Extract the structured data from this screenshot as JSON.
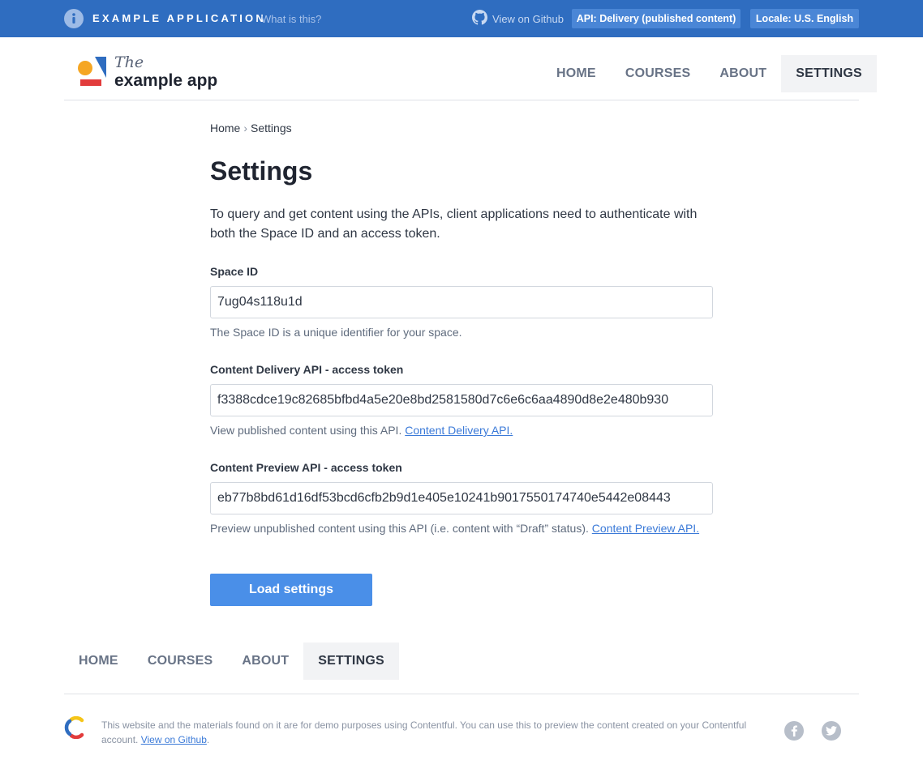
{
  "topbar": {
    "app_title": "EXAMPLE APPLICATION",
    "what_link": "What is this?",
    "github_link": "View on Github",
    "api_pill": "API: Delivery (published content)",
    "locale_pill": "Locale: U.S. English",
    "bg_color": "#2f6dc0",
    "icons": [
      "info-icon",
      "github-icon"
    ]
  },
  "logo": {
    "the": "The",
    "word": "example app"
  },
  "nav": {
    "items": [
      "HOME",
      "COURSES",
      "ABOUT",
      "SETTINGS"
    ],
    "active": "SETTINGS"
  },
  "breadcrumb": {
    "home": "Home",
    "separator": "›",
    "current": "Settings"
  },
  "page": {
    "title": "Settings",
    "intro": "To query and get content using the APIs, client applications need to authenticate with both the Space ID and an access token."
  },
  "fields": {
    "space_id": {
      "label": "Space ID",
      "value": "7ug04s118u1d",
      "help": "The Space ID is a unique identifier for your space."
    },
    "delivery_token": {
      "label": "Content Delivery API - access token",
      "value": "f3388cdce19c82685bfbd4a5e20e8bd2581580d7c6e6c6aa4890d8e2e480b930",
      "help": "View published content using this API.",
      "help_link": "Content Delivery API."
    },
    "preview_token": {
      "label": "Content Preview API - access token",
      "value": "eb77b8bd61d16df53bcd6cfb2b9d1e405e10241b9017550174740e5442e08443",
      "help": "Preview unpublished content using this API (i.e. content with “Draft” status).",
      "help_link": "Content Preview API."
    }
  },
  "load_button": "Load settings",
  "accent_color": "#4a8fe8",
  "footer": {
    "text": "This website and the materials found on it are for demo purposes using Contentful. You can use this to preview the content created on your Contentful account.",
    "link": "View on Github",
    "trailing": ".",
    "icons": [
      "contentful-logo-icon",
      "facebook-icon",
      "twitter-icon"
    ]
  }
}
